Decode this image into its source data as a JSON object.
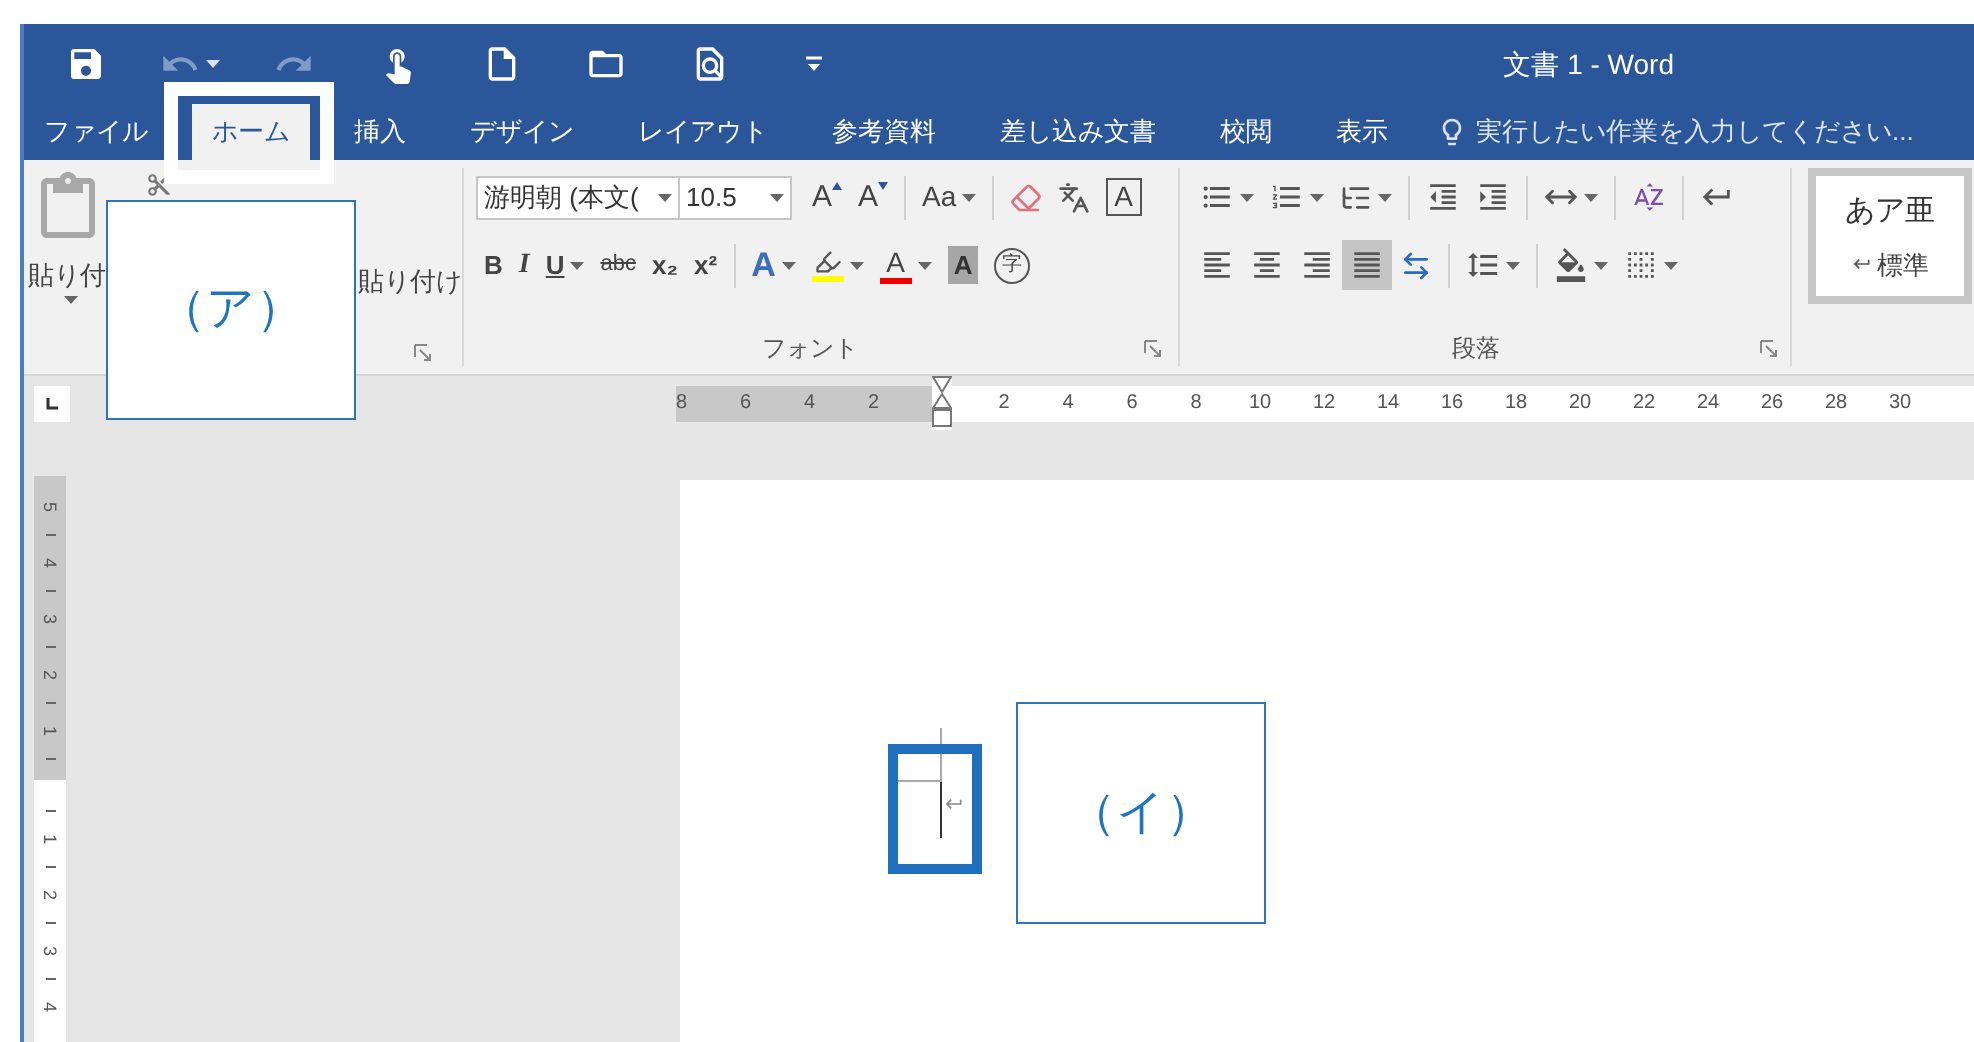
{
  "title_bar": {
    "title": "文書 1 - Word",
    "quick_access": [
      {
        "kind": "save",
        "disabled": false
      },
      {
        "kind": "undo",
        "disabled": true
      },
      {
        "kind": "redo",
        "disabled": true
      },
      {
        "kind": "touch",
        "disabled": false
      },
      {
        "kind": "new",
        "disabled": false
      },
      {
        "kind": "open",
        "disabled": false
      },
      {
        "kind": "preview",
        "disabled": false
      },
      {
        "kind": "customize",
        "disabled": false
      }
    ]
  },
  "tabs": [
    {
      "label": "ファイル",
      "selected": false
    },
    {
      "label": "ホーム",
      "selected": true
    },
    {
      "label": "挿入",
      "selected": false
    },
    {
      "label": "デザイン",
      "selected": false
    },
    {
      "label": "レイアウト",
      "selected": false
    },
    {
      "label": "参考資料",
      "selected": false
    },
    {
      "label": "差し込み文書",
      "selected": false
    },
    {
      "label": "校閲",
      "selected": false
    },
    {
      "label": "表示",
      "selected": false
    }
  ],
  "tell_me": {
    "placeholder": "実行したい作業を入力してください..."
  },
  "clipboard": {
    "paste_label": "貼り付",
    "format_painter_label": "貼り付け"
  },
  "font": {
    "name": "游明朝 (本文(",
    "size": "10.5",
    "group_label": "フォント",
    "row1": [
      [
        {
          "kind": "grow",
          "label": "A",
          "dropdown": false
        },
        {
          "kind": "shrink",
          "label": "A",
          "dropdown": false
        }
      ],
      [
        {
          "kind": "case",
          "label": "Aa",
          "dropdown": true
        }
      ],
      [
        {
          "kind": "clear",
          "dropdown": false
        },
        {
          "kind": "phonetic",
          "dropdown": false
        },
        {
          "kind": "char-border",
          "label": "A",
          "dropdown": false
        }
      ]
    ],
    "row2": [
      [
        {
          "kind": "bold",
          "label": "B",
          "dropdown": false
        },
        {
          "kind": "italic",
          "label": "I",
          "dropdown": false
        },
        {
          "kind": "underline",
          "label": "U",
          "dropdown": true
        },
        {
          "kind": "strike",
          "label": "abc",
          "dropdown": false
        },
        {
          "kind": "subscript",
          "label": "x₂",
          "dropdown": false
        },
        {
          "kind": "superscript",
          "label": "x²",
          "dropdown": false
        }
      ],
      [
        {
          "kind": "effects",
          "label": "A",
          "dropdown": true
        },
        {
          "kind": "highlight",
          "dropdown": true
        },
        {
          "kind": "font-color",
          "label": "A",
          "dropdown": true
        },
        {
          "kind": "shading",
          "label": "A",
          "dropdown": false
        },
        {
          "kind": "enclose",
          "label": "字",
          "dropdown": false
        }
      ]
    ]
  },
  "paragraph": {
    "group_label": "段落",
    "row1": [
      [
        {
          "kind": "bullets",
          "dropdown": true
        },
        {
          "kind": "numbering",
          "dropdown": true
        },
        {
          "kind": "multilevel",
          "dropdown": true
        }
      ],
      [
        {
          "kind": "decrease-indent",
          "dropdown": false
        },
        {
          "kind": "increase-indent",
          "dropdown": false
        }
      ],
      [
        {
          "kind": "asian-layout",
          "dropdown": true
        }
      ],
      [
        {
          "kind": "sort",
          "dropdown": false
        }
      ],
      [
        {
          "kind": "show-marks",
          "dropdown": false
        }
      ]
    ],
    "row2": [
      [
        {
          "kind": "align-left",
          "dropdown": false,
          "selected": false
        },
        {
          "kind": "align-center",
          "dropdown": false,
          "selected": false
        },
        {
          "kind": "align-right",
          "dropdown": false,
          "selected": false
        },
        {
          "kind": "justify",
          "dropdown": false,
          "selected": true
        },
        {
          "kind": "distributed",
          "dropdown": false,
          "selected": false
        }
      ],
      [
        {
          "kind": "line-spacing",
          "dropdown": true
        }
      ],
      [
        {
          "kind": "para-shading",
          "dropdown": true
        },
        {
          "kind": "borders",
          "dropdown": true
        }
      ]
    ]
  },
  "styles": {
    "preview": "あア亜",
    "name": "標準"
  },
  "ruler": {
    "left_ticks": [
      "8",
      "6",
      "4",
      "2"
    ],
    "right_ticks": [
      "2",
      "4",
      "6",
      "8",
      "10",
      "12",
      "14",
      "16",
      "18",
      "20",
      "22",
      "24",
      "26",
      "28",
      "30"
    ]
  },
  "vertical_ruler": {
    "upper_ticks": [
      "5",
      "4",
      "3",
      "2",
      "1"
    ],
    "lower_ticks": [
      "1",
      "2",
      "3",
      "4"
    ]
  },
  "callouts": [
    {
      "label": "（ア）"
    },
    {
      "label": "（イ）"
    }
  ]
}
